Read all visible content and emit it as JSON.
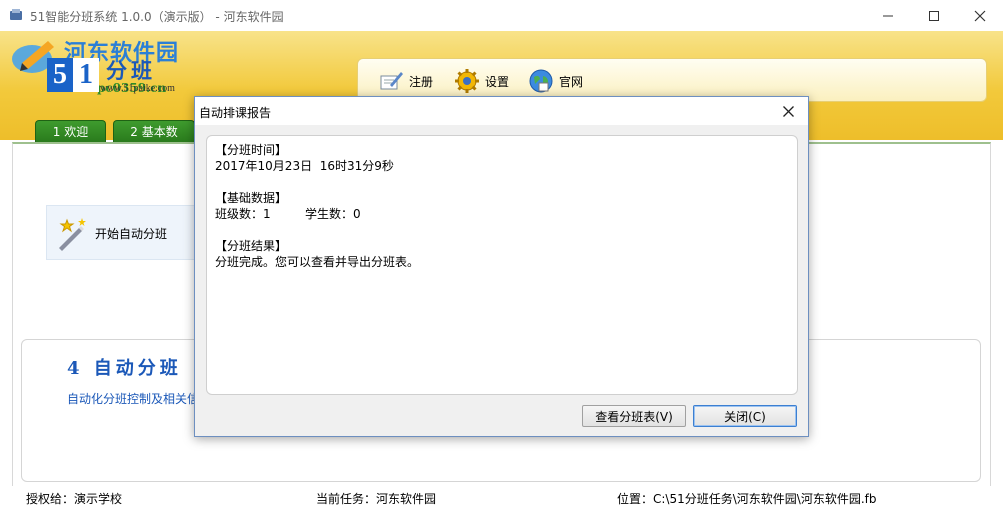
{
  "window": {
    "title": "51智能分班系统 1.0.0（演示版） - 河东软件园",
    "minimize_icon": "minimize-icon",
    "maximize_icon": "maximize-icon",
    "close_icon": "close-icon"
  },
  "watermark": {
    "title": "河东软件园",
    "url": "www.pc0359.cn"
  },
  "logo": {
    "digit_5": "5",
    "digit_1": "1",
    "text": "分班",
    "url": "www.51paike.com"
  },
  "toolbar": {
    "register_label": "注册",
    "settings_label": "设置",
    "website_label": "官网"
  },
  "tabs": [
    {
      "label": "1 欢迎"
    },
    {
      "label": "2 基本数"
    }
  ],
  "main": {
    "start_button_label": "开始自动分班",
    "step_title": "4 自动分班",
    "step_desc": "自动化分班控制及相关信"
  },
  "statusbar": {
    "licensee": "授权给：演示学校",
    "task": "当前任务：河东软件园",
    "location": "位置：C:\\51分班任务\\河东软件园\\河东软件园.fb"
  },
  "dialog": {
    "title": "自动排课报告",
    "report": {
      "time_header": "【分班时间】",
      "time_value": "2017年10月23日  16时31分9秒",
      "data_header": "【基础数据】",
      "data_value": "班级数：1         学生数：0",
      "result_header": "【分班结果】",
      "result_value": "分班完成。您可以查看并导出分班表。"
    },
    "view_button": "查看分班表(V)",
    "close_button": "关闭(C)"
  },
  "colors": {
    "header_yellow": "#f2c93b",
    "tab_green": "#2a7b1c",
    "brand_blue": "#1b58b8"
  }
}
